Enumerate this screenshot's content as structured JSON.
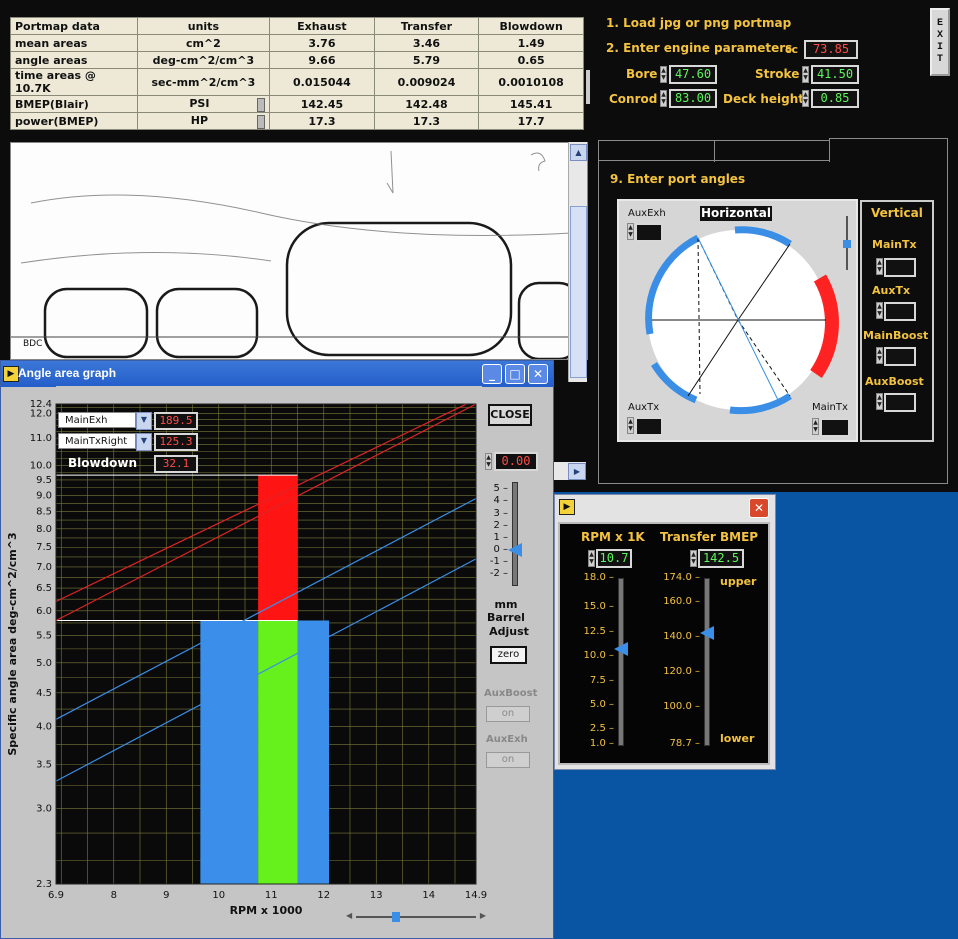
{
  "portmap_table": {
    "headers": [
      "Portmap data",
      "units",
      "Exhaust",
      "Transfer",
      "Blowdown"
    ],
    "rows": [
      [
        "mean areas",
        "cm^2",
        "3.76",
        "3.46",
        "1.49"
      ],
      [
        "angle areas",
        "deg-cm^2/cm^3",
        "9.66",
        "5.79",
        "0.65"
      ],
      [
        "time areas @ 10.7K",
        "sec-mm^2/cm^3",
        "0.015044",
        "0.009024",
        "0.0010108"
      ],
      [
        "BMEP(Blair)",
        "PSI",
        "142.45",
        "142.48",
        "145.41"
      ],
      [
        "power(BMEP)",
        "HP",
        "17.3",
        "17.3",
        "17.7"
      ]
    ]
  },
  "steps": {
    "step1": "1. Load jpg or png portmap",
    "step2": "2. Enter engine parameters",
    "step9": "9. Enter port angles"
  },
  "engine": {
    "cc_label": "cc",
    "cc_value": "73.85",
    "bore_label": "Bore",
    "bore_value": "47.60",
    "stroke_label": "Stroke",
    "stroke_value": "41.50",
    "conrod_label": "Conrod",
    "conrod_value": "83.00",
    "deck_label": "Deck height",
    "deck_value": "0.85"
  },
  "exit_label": "E\nX\nI\nT",
  "portmap_image": {
    "bdc_label": "BDC"
  },
  "port_angles": {
    "aux_exh_label": "AuxExh",
    "horizontal_label": "Horizontal",
    "aux_tx_label": "AuxTx",
    "main_tx_label": "MainTx",
    "vertical_label": "Vertical",
    "vertical_items": [
      "MainTx",
      "AuxTx",
      "MainBoost",
      "AuxBoost"
    ]
  },
  "angle_window": {
    "title": "Angle area graph",
    "close_label": "CLOSE",
    "legend": [
      {
        "label": "MainExh",
        "value": "189.5"
      },
      {
        "label": "MainTxRight",
        "value": "125.3"
      },
      {
        "label": "Blowdown",
        "value": "32.1"
      }
    ],
    "barrel_value": "0.00",
    "barrel_ticks": [
      "5",
      "4",
      "3",
      "2",
      "1",
      "0",
      "-1",
      "-2"
    ],
    "barrel_label_1": "mm",
    "barrel_label_2": "Barrel",
    "barrel_label_3": "Adjust",
    "zero_label": "zero",
    "aux_boost_label": "AuxBoost",
    "aux_boost_btn": "on",
    "aux_exh_label": "AuxExh",
    "aux_exh_btn": "on",
    "barrel_level": 0
  },
  "chart_data": {
    "type": "line",
    "xlabel": "RPM x 1000",
    "ylabel": "Specific angle area  deg-cm^2/cm^3",
    "xlim": [
      6.9,
      14.9
    ],
    "ylim": [
      2.3,
      12.4
    ],
    "y_scale": "log",
    "x_ticks": [
      "6.9",
      "8",
      "9",
      "10",
      "11",
      "12",
      "13",
      "14",
      "14.9"
    ],
    "y_ticks": [
      "12.4",
      "12.0",
      "11.0",
      "10.0",
      "9.5",
      "9.0",
      "8.5",
      "8.0",
      "7.5",
      "7.0",
      "6.5",
      "6.0",
      "5.5",
      "5.0",
      "4.5",
      "4.0",
      "3.5",
      "3.0",
      "2.3"
    ],
    "grid": true,
    "series": [
      {
        "color": "#e02424",
        "x": [
          6.9,
          14.9
        ],
        "y": [
          6.2,
          12.6
        ]
      },
      {
        "color": "#e02424",
        "x": [
          6.9,
          14.9
        ],
        "y": [
          5.8,
          12.4
        ]
      },
      {
        "color": "#3a8ee6",
        "x": [
          6.9,
          14.9
        ],
        "y": [
          4.1,
          8.9
        ]
      },
      {
        "color": "#3a8ee6",
        "x": [
          6.9,
          14.9
        ],
        "y": [
          3.3,
          7.2
        ]
      }
    ],
    "bars": [
      {
        "color": "#3b8fea",
        "x0": 9.65,
        "x1": 10.75,
        "y0": 2.3,
        "y1": 5.8
      },
      {
        "color": "#66f01c",
        "x0": 10.75,
        "x1": 11.5,
        "y0": 2.3,
        "y1": 5.8
      },
      {
        "color": "#3b8fea",
        "x0": 11.5,
        "x1": 12.1,
        "y0": 2.3,
        "y1": 5.8
      },
      {
        "color": "#ff1414",
        "x0": 10.75,
        "x1": 11.5,
        "y0": 5.8,
        "y1": 9.66
      }
    ],
    "h_lines": [
      9.66,
      5.8
    ]
  },
  "rpm_window": {
    "rpm_label": "RPM x 1K",
    "rpm_value": "10.7",
    "rpm_ticks": [
      "18.0",
      "15.0",
      "12.5",
      "10.0",
      "7.5",
      "5.0",
      "2.5",
      "1.0"
    ],
    "rpm_level": 10.7,
    "bmep_label": "Transfer BMEP",
    "bmep_value": "142.5",
    "bmep_ticks": [
      "174.0",
      "160.0",
      "140.0",
      "120.0",
      "100.0",
      "78.7"
    ],
    "bmep_level": 142.5,
    "upper_label": "upper",
    "lower_label": "lower"
  }
}
